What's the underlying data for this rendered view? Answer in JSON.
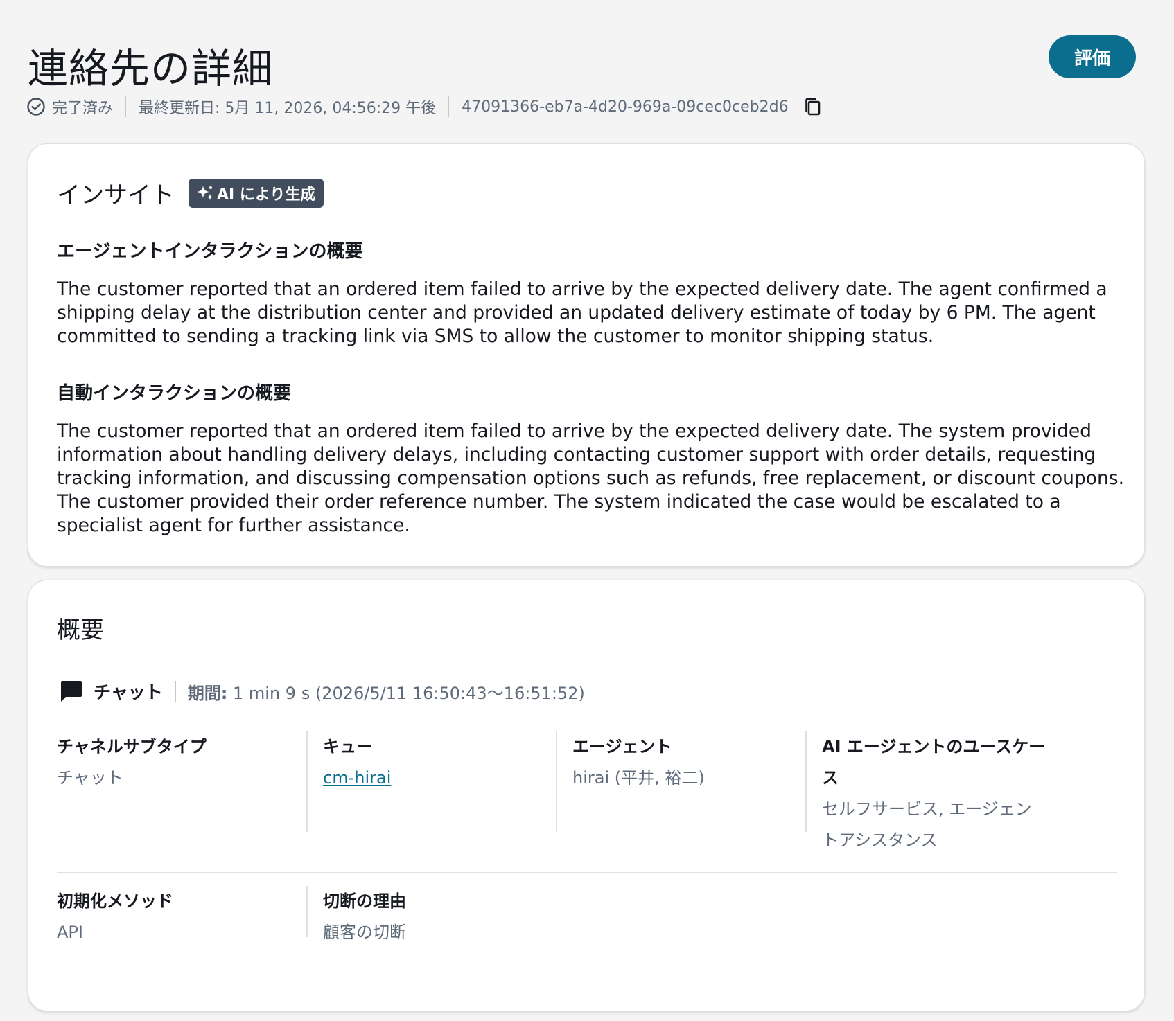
{
  "header": {
    "title": "連絡先の詳細",
    "eval_button": "評価",
    "status": "完了済み",
    "last_updated": "最終更新日: 5月 11, 2026, 04:56:29 午後",
    "contact_id": "47091366-eb7a-4d20-969a-09cec0ceb2d6"
  },
  "insight": {
    "title": "インサイト",
    "ai_badge": "AI により生成",
    "agent_heading": "エージェントインタラクションの概要",
    "agent_text": "The customer reported that an ordered item failed to arrive by the expected delivery date. The agent confirmed a shipping delay at the distribution center and provided an updated delivery estimate of today by 6 PM. The agent committed to sending a tracking link via SMS to allow the customer to monitor shipping status.",
    "auto_heading": "自動インタラクションの概要",
    "auto_text": "The customer reported that an ordered item failed to arrive by the expected delivery date. The system provided information about handling delivery delays, including contacting customer support with order details, requesting tracking information, and discussing compensation options such as refunds, free replacement, or discount coupons. The customer provided their order reference number. The system indicated the case would be escalated to a specialist agent for further assistance."
  },
  "summary": {
    "title": "概要",
    "channel": "チャット",
    "duration_label": "期間:",
    "duration_value": "1 min 9 s (2026/5/11 16:50:43〜16:51:52)",
    "fields": {
      "channel_subtype_label": "チャネルサブタイプ",
      "channel_subtype_value": "チャット",
      "queue_label": "キュー",
      "queue_value": "cm-hirai",
      "agent_label": "エージェント",
      "agent_value": "hirai (平井, 裕二)",
      "ai_usecase_label": "AI エージェントのユースケース",
      "ai_usecase_value": "セルフサービス, エージェントアシスタンス",
      "init_method_label": "初期化メソッド",
      "init_method_value": "API",
      "disconnect_reason_label": "切断の理由",
      "disconnect_reason_value": "顧客の切断"
    }
  },
  "colors": {
    "primary_button": "#0b6e8f",
    "badge_bg": "#414d5c",
    "link": "#0b6e8f"
  },
  "icons": {
    "status": "check-circle-icon",
    "copy": "copy-icon",
    "ai": "sparkle-icon",
    "channel": "chat-bubble-icon"
  }
}
